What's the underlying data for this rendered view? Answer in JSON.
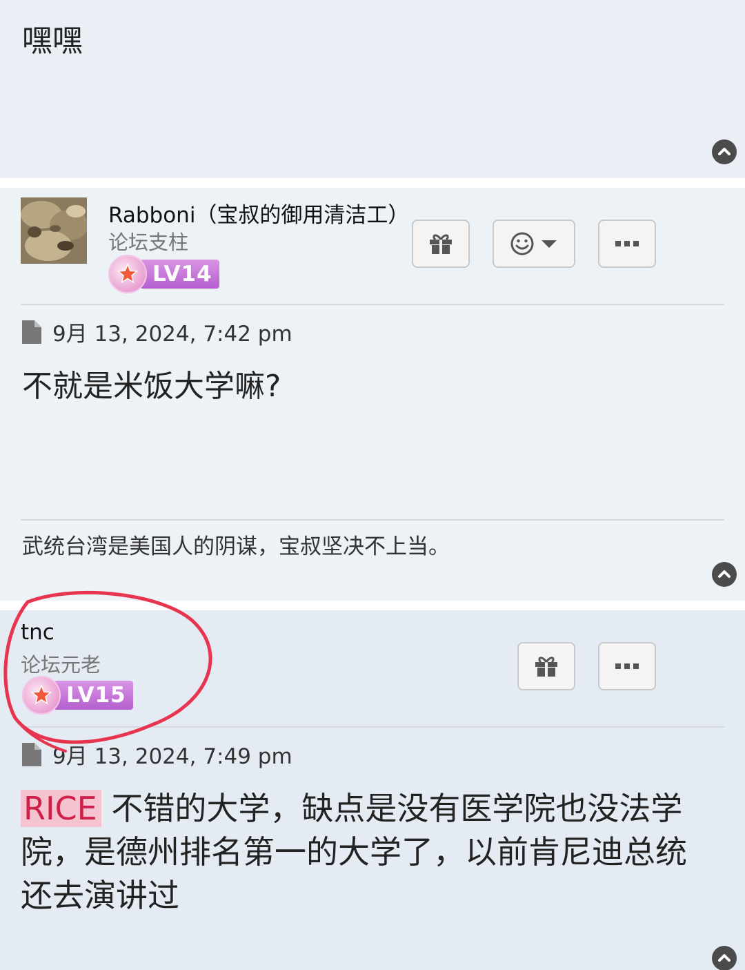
{
  "posts": {
    "top": {
      "text": "嘿嘿"
    },
    "rabboni": {
      "username": "Rabboni（宝叔的御用清洁工）",
      "rank": "论坛支柱",
      "level": "LV14",
      "timestamp": "9月 13, 2024, 7:42 pm",
      "content": "不就是米饭大学嘛?",
      "signature": "武统台湾是美国人的阴谋，宝叔坚决不上当。"
    },
    "tnc": {
      "username": "tnc",
      "rank": "论坛元老",
      "level": "LV15",
      "timestamp": "9月 13, 2024, 7:49 pm",
      "content_highlight": "RICE",
      "content_rest": " 不错的大学，缺点是没有医学院也没法学院，是德州排名第一的大学了，以前肯尼迪总统还去演讲过"
    }
  },
  "icons": {
    "scroll_top": "chevron-up-circle-icon",
    "gift": "gift-icon",
    "reaction": "smiley-icon",
    "more": "ellipsis-icon",
    "post": "file-icon"
  },
  "colors": {
    "highlight_bg": "#f6c4d0",
    "highlight_text": "#d0204a",
    "level_badge": "#b45fcf",
    "annotation_circle": "#e8354f"
  }
}
